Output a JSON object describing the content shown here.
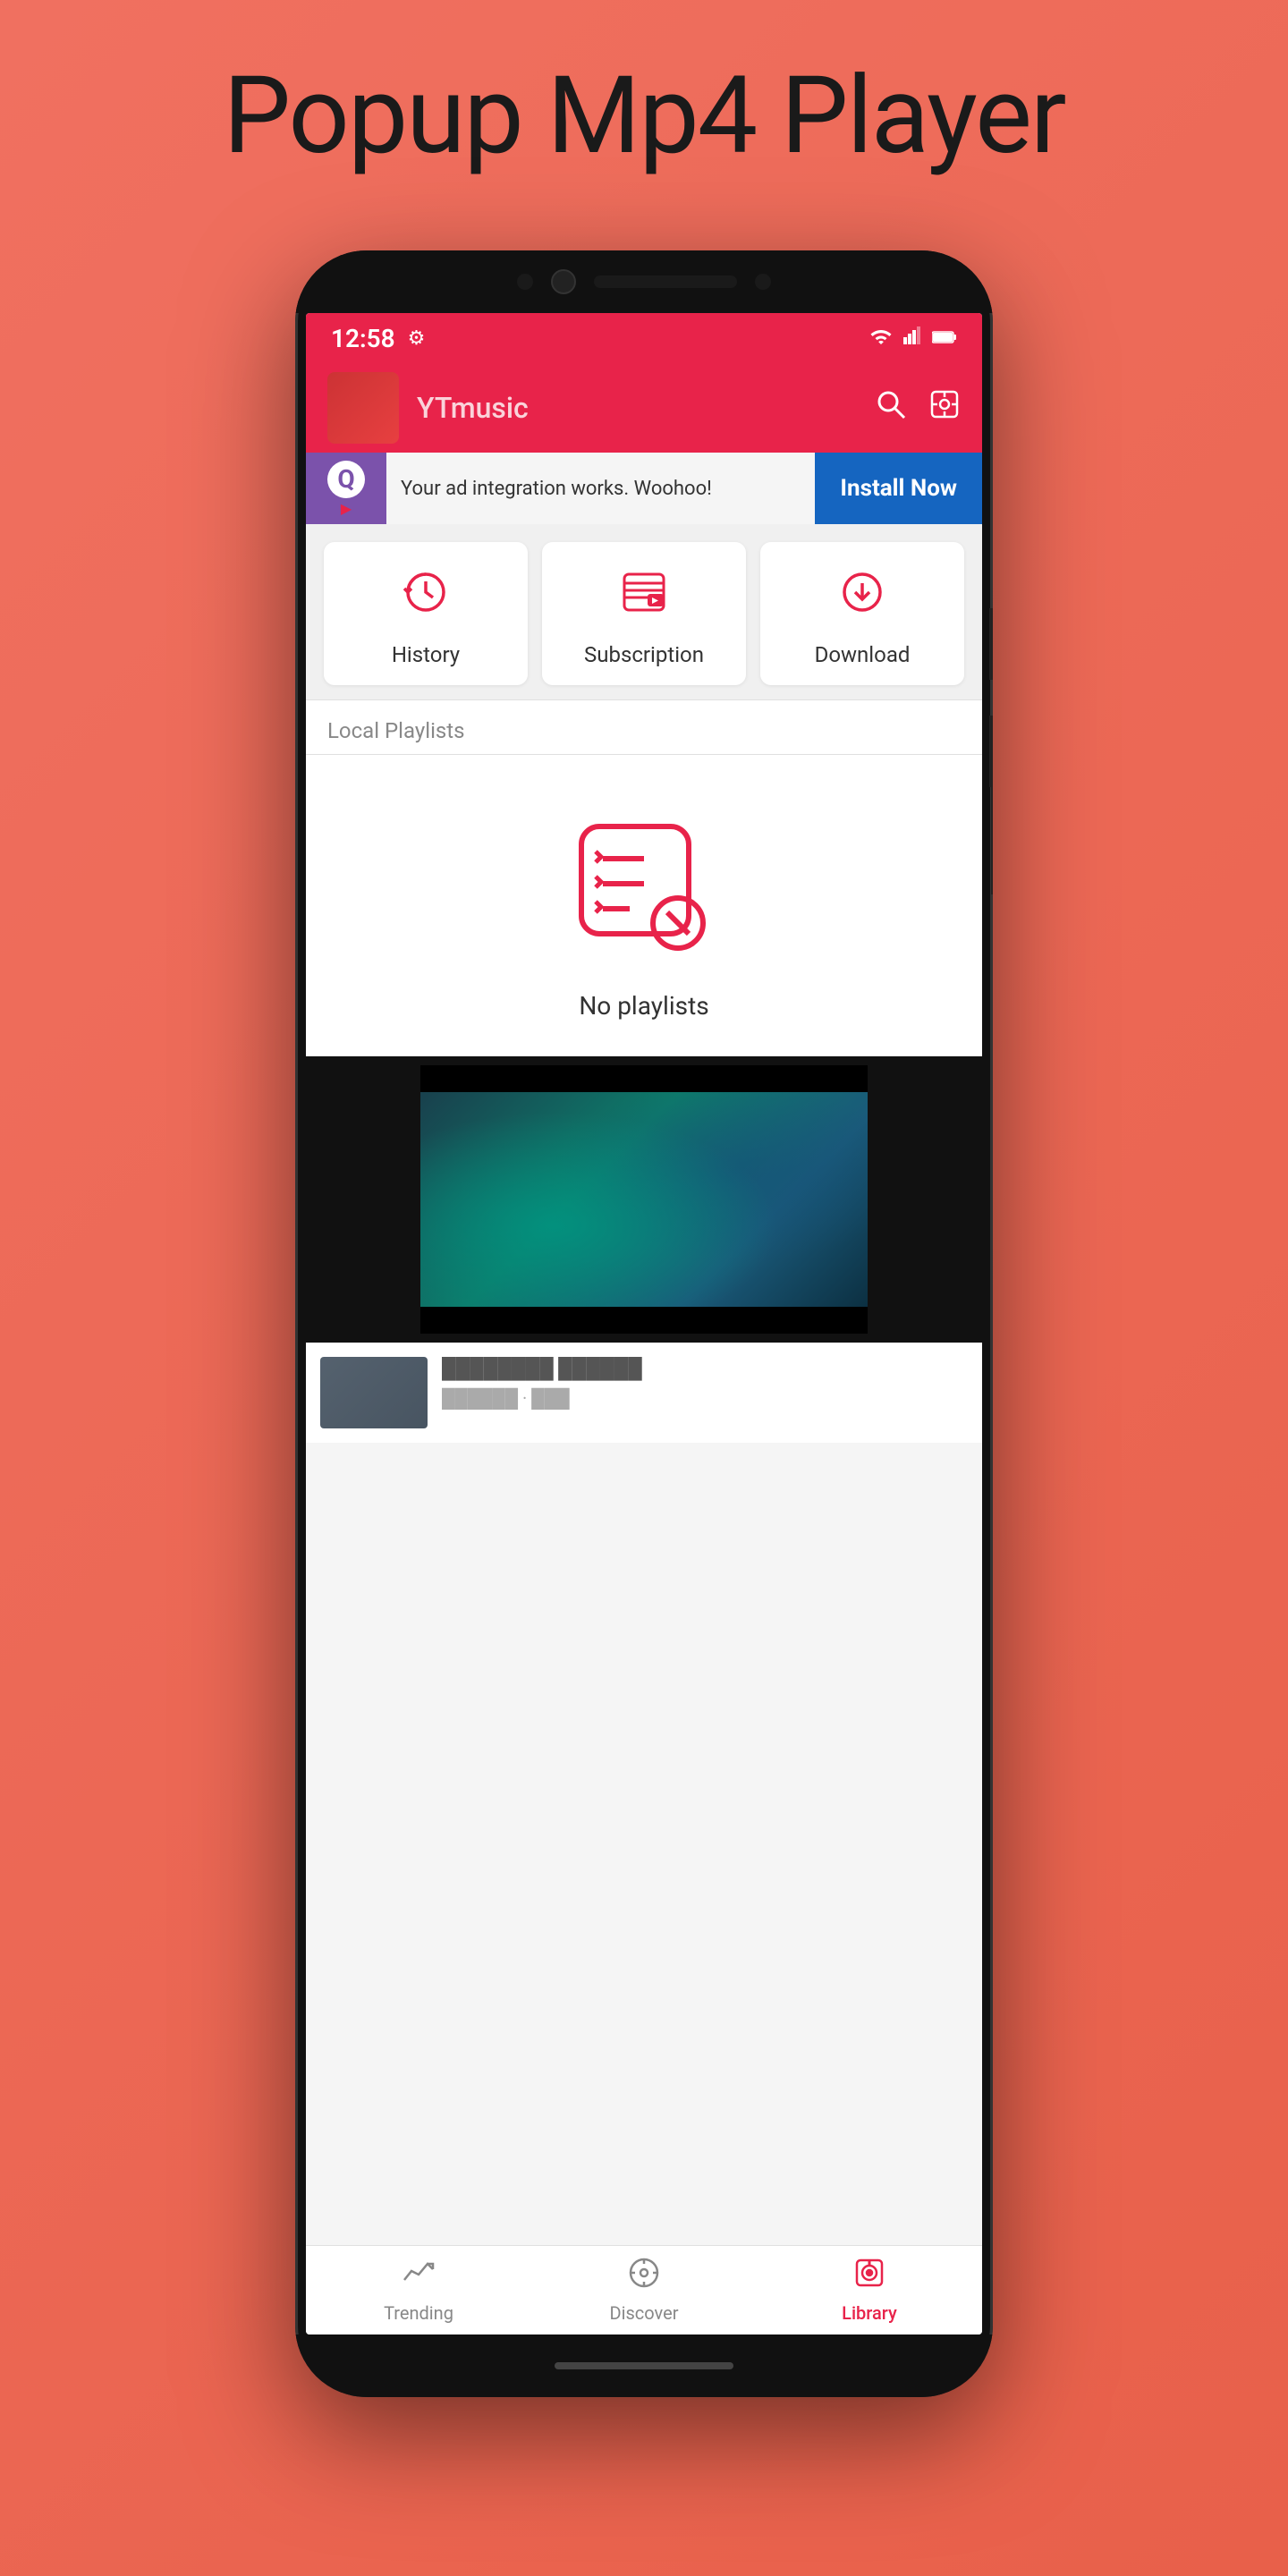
{
  "page": {
    "title": "Popup Mp4 Player",
    "background_color": "#e86a50"
  },
  "status_bar": {
    "time": "12:58",
    "settings_icon": "⚙",
    "wifi_icon": "▼",
    "signal_icon": "◢",
    "battery_icon": "▭"
  },
  "header": {
    "title": "YTmusic",
    "search_icon": "🔍",
    "settings_icon": "⚙"
  },
  "ad_banner": {
    "text": "Your ad integration works. Woohoo!",
    "install_button": "Install Now"
  },
  "feature_cards": [
    {
      "id": "history",
      "label": "History",
      "icon": "history"
    },
    {
      "id": "subscription",
      "label": "Subscription",
      "icon": "subscription"
    },
    {
      "id": "download",
      "label": "Download",
      "icon": "download"
    }
  ],
  "local_playlists": {
    "section_title": "Local Playlists",
    "empty_message": "No playlists"
  },
  "nav_bar": {
    "items": [
      {
        "id": "trending",
        "label": "Trending",
        "icon": "📈",
        "active": false
      },
      {
        "id": "discover",
        "label": "Discover",
        "icon": "🧭",
        "active": false
      },
      {
        "id": "library",
        "label": "Library",
        "icon": "🎵",
        "active": true
      }
    ]
  }
}
